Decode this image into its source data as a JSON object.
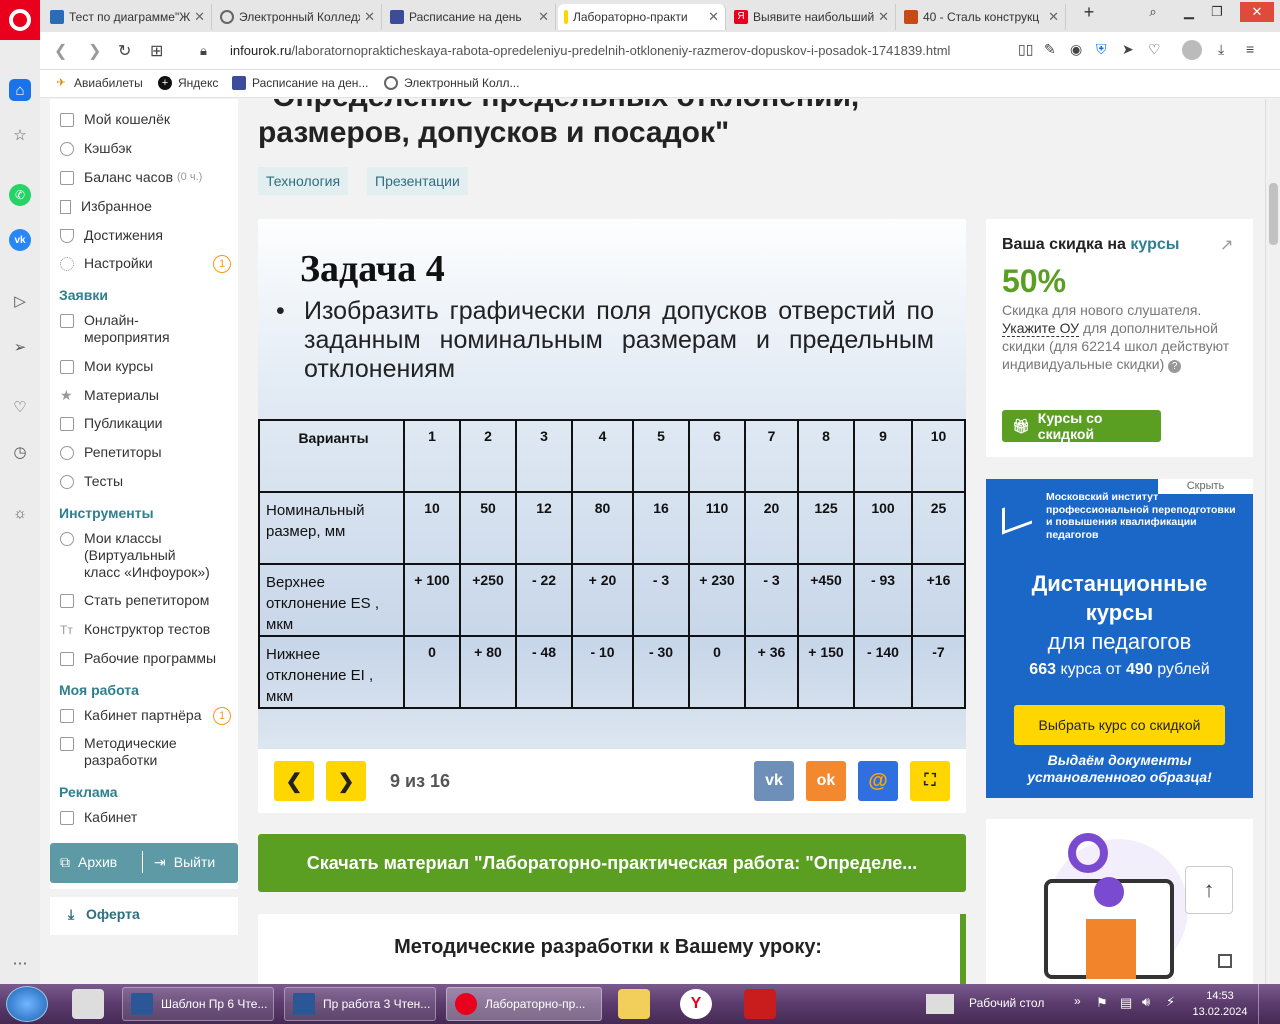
{
  "browser": {
    "tabs": [
      {
        "label": "Тест по диаграмме\"Ж",
        "icon": "blue-book-icon",
        "color": "#2a6db5"
      },
      {
        "label": "Электронный Колледж",
        "icon": "globe-icon",
        "color": "#666666"
      },
      {
        "label": "Расписание на день",
        "icon": "flag-icon",
        "color": "#3b4d9a"
      },
      {
        "label": "Лабораторно-практи",
        "icon": "bookmark-yellow-icon",
        "color": "#ffd600",
        "active": true
      },
      {
        "label": "Выявите наибольший",
        "icon": "yandex-icon",
        "color": "#e8001c"
      },
      {
        "label": "40 - Сталь конструкц",
        "icon": "fire-icon",
        "color": "#c84a12"
      }
    ],
    "new_tab_label": "+",
    "url_domain": "infourok.ru",
    "url_path": "/laboratornoprakticheskaya-rabota-opredeleniyu-predelnih-otkloneniy-razmerov-dopuskov-i-posadok-1741839.html",
    "bookmarks": [
      "Авиабилеты",
      "Яндекс",
      "Расписание на ден...",
      "Электронный Колл..."
    ]
  },
  "leftmenu": {
    "items_top": [
      {
        "label": "Мой кошелёк"
      },
      {
        "label": "Кэшбэк"
      },
      {
        "label": "Баланс часов",
        "extra": "(0 ч.)"
      },
      {
        "label": "Избранное"
      },
      {
        "label": "Достижения"
      },
      {
        "label": "Настройки",
        "badge": "1"
      }
    ],
    "section_requests": "Заявки",
    "items_requests": [
      {
        "label": "Онлайн-\nмероприятия"
      },
      {
        "label": "Мои курсы"
      },
      {
        "label": "Материалы"
      },
      {
        "label": "Публикации"
      },
      {
        "label": "Репетиторы"
      },
      {
        "label": "Тесты"
      }
    ],
    "section_tools": "Инструменты",
    "items_tools": [
      {
        "label": "Мои классы\n(Виртуальный\nкласс «Инфоурок»)"
      },
      {
        "label": "Стать репетитором"
      },
      {
        "label": "Конструктор тестов"
      },
      {
        "label": "Рабочие программы"
      }
    ],
    "section_work": "Моя работа",
    "items_work": [
      {
        "label": "Кабинет партнёра",
        "badge": "1"
      },
      {
        "label": "Методические\nразработки"
      }
    ],
    "section_ads": "Реклама",
    "items_ads": [
      {
        "label": "Кабинет"
      }
    ],
    "archive": "Архив",
    "logout": "Выйти",
    "oferta": "Оферта"
  },
  "main": {
    "title_line1": "\"Определение предельных отклонений,",
    "title_line2": "размеров, допусков и посадок\"",
    "tags": [
      "Технология",
      "Презентации"
    ],
    "slide": {
      "title": "Задача 4",
      "bullet": "Изобразить графически поля допусков отверстий по заданным номинальным размерам и предельным отклонениям",
      "table": {
        "header_label": "Варианты",
        "variants": [
          "1",
          "2",
          "3",
          "4",
          "5",
          "6",
          "7",
          "8",
          "9",
          "10"
        ],
        "rows": [
          {
            "label": "Номинальный размер, мм",
            "values": [
              "10",
              "50",
              "12",
              "80",
              "16",
              "110",
              "20",
              "125",
              "100",
              "25"
            ]
          },
          {
            "label": "Верхнее отклонение ES , мкм",
            "values": [
              "+ 100",
              "+250",
              "- 22",
              "+ 20",
              "- 3",
              "+ 230",
              "- 3",
              "+450",
              "- 93",
              "+16"
            ]
          },
          {
            "label": "Нижнее отклонение EI , мкм",
            "values": [
              "0",
              "+ 80",
              "- 48",
              "- 10",
              "- 30",
              "0",
              "+ 36",
              "+ 150",
              "- 140",
              "-7"
            ]
          }
        ]
      }
    },
    "pager": "9 из 16",
    "share": {
      "vk": "vk",
      "ok": "ok",
      "mail": "@"
    },
    "download_button": "Скачать материал \"Лабораторно-практическая работа: \"Определе...",
    "methodical_heading": "Методические разработки к Вашему уроку:"
  },
  "right": {
    "discount_title_prefix": "Ваша скидка на",
    "discount_title_link": "курсы",
    "discount_percent": "50%",
    "discount_text1": "Скидка для нового слушателя.",
    "discount_link": "Укажите ОУ",
    "discount_text2": "для дополнительной скидки (для 62214 школ действуют индивидуальные скидки)",
    "discount_button": "Курсы со скидкой",
    "ad_hide": "Скрыть",
    "ad_org": "Московский институт профессиональной переподготовки и повышения квалификации педагогов",
    "ad_title1": "Дистанционные",
    "ad_title2": "курсы",
    "ad_title3": "для педагогов",
    "ad_count": "663",
    "ad_count_text": "курса от",
    "ad_price": "490",
    "ad_price_text": "рублей",
    "ad_button": "Выбрать курс со скидкой",
    "ad_footer": "Выдаём документы установленного образца!"
  },
  "taskbar": {
    "windows": [
      {
        "label": "Шаблон Пр 6 Чте..."
      },
      {
        "label": "Пр работа 3 Чтен..."
      },
      {
        "label": "Лабораторно-пр..."
      }
    ],
    "desktop_label": "Рабочий стол",
    "time": "14:53",
    "date": "13.02.2024"
  },
  "colors": {
    "accent_green": "#5a9f22",
    "brand_teal": "#2e7f8f",
    "ad_blue": "#1a67c8",
    "yellow": "#ffd600"
  }
}
